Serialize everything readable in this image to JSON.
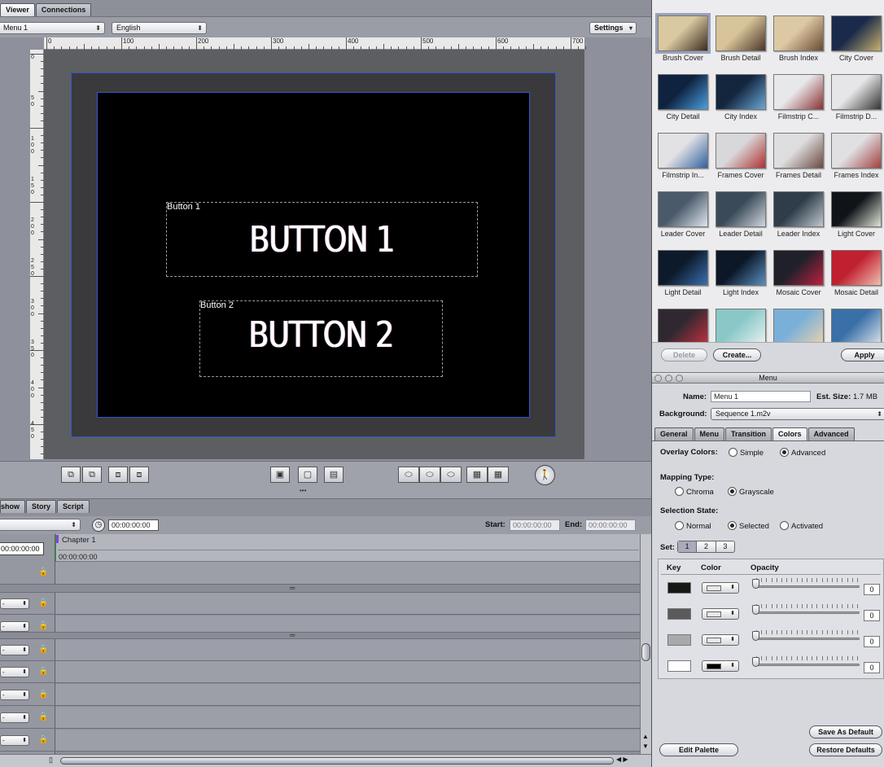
{
  "viewer": {
    "tabs": [
      "Viewer",
      "Connections"
    ],
    "menu_select": "Menu 1",
    "language_select": "English",
    "settings_label": "Settings",
    "ruler_h": [
      "0",
      "100",
      "200",
      "300",
      "400",
      "500",
      "600",
      "700"
    ],
    "ruler_v": [
      "0",
      "5\n0",
      "1\n0\n0",
      "1\n5\n0",
      "2\n0\n0",
      "2\n5\n0",
      "3\n0\n0",
      "3\n5\n0",
      "4\n0\n0",
      "4\n5\n0"
    ],
    "buttons": [
      {
        "caption": "Button 1",
        "text": "BUTTON 1"
      },
      {
        "caption": "Button 2",
        "text": "BUTTON 2"
      }
    ],
    "handle": "•••"
  },
  "timeline": {
    "tabs": [
      "show",
      "Story",
      "Script"
    ],
    "timecode": "00:00:00:00",
    "start_label": "Start:",
    "start_value": "00:00:00:00",
    "end_label": "End:",
    "end_value": "00:00:00:00",
    "chapter": "Chapter 1",
    "ruler_time": "00:00:00:00",
    "left_time": "00:00:00:00",
    "track_pop": "-"
  },
  "templates": {
    "items": [
      {
        "label": "Brush Cover",
        "c1": "#d9c8a0",
        "c2": "#3a2b20"
      },
      {
        "label": "Brush Detail",
        "c1": "#d8c49a",
        "c2": "#4a3528"
      },
      {
        "label": "Brush Index",
        "c1": "#dcc9a3",
        "c2": "#6b4a30"
      },
      {
        "label": "City Cover",
        "c1": "#1a2a4a",
        "c2": "#c8b070"
      },
      {
        "label": "City Detail",
        "c1": "#0f2340",
        "c2": "#4aa0e0"
      },
      {
        "label": "City Index",
        "c1": "#14263e",
        "c2": "#6aa8d8"
      },
      {
        "label": "Filmstrip C...",
        "c1": "#e8e8ea",
        "c2": "#8a3030"
      },
      {
        "label": "Filmstrip D...",
        "c1": "#e6e6e8",
        "c2": "#333333"
      },
      {
        "label": "Filmstrip In...",
        "c1": "#e2e2e4",
        "c2": "#3060a0"
      },
      {
        "label": "Frames Cover",
        "c1": "#d8d8da",
        "c2": "#b03030"
      },
      {
        "label": "Frames Detail",
        "c1": "#dedee0",
        "c2": "#6a4a40"
      },
      {
        "label": "Frames Index",
        "c1": "#e0e0e2",
        "c2": "#a04040"
      },
      {
        "label": "Leader Cover",
        "c1": "#4a5a6a",
        "c2": "#dfe6ee"
      },
      {
        "label": "Leader Detail",
        "c1": "#3a4a58",
        "c2": "#d0d6de"
      },
      {
        "label": "Leader Index",
        "c1": "#2f3d4a",
        "c2": "#c0c8d0"
      },
      {
        "label": "Light Cover",
        "c1": "#101418",
        "c2": "#e0e4d8"
      },
      {
        "label": "Light Detail",
        "c1": "#0c1a2a",
        "c2": "#3a70b0"
      },
      {
        "label": "Light Index",
        "c1": "#0c1828",
        "c2": "#5a90c0"
      },
      {
        "label": "Mosaic Cover",
        "c1": "#20202a",
        "c2": "#c02040"
      },
      {
        "label": "Mosaic Detail",
        "c1": "#c02030",
        "c2": "#f0c0b0"
      },
      {
        "label": "",
        "c1": "#302830",
        "c2": "#c03040"
      },
      {
        "label": "",
        "c1": "#8ac8c8",
        "c2": "#e8f0f0"
      },
      {
        "label": "",
        "c1": "#7ab0d8",
        "c2": "#e8d0b0"
      },
      {
        "label": "",
        "c1": "#3a70a8",
        "c2": "#d8e0e8"
      }
    ],
    "delete_label": "Delete",
    "create_label": "Create...",
    "apply_label": "Apply"
  },
  "menu_inspector": {
    "title": "Menu",
    "name_label": "Name:",
    "name_value": "Menu 1",
    "size_label": "Est. Size:",
    "size_value": "1.7 MB",
    "background_label": "Background:",
    "background_value": "Sequence 1.m2v",
    "tabs": [
      "General",
      "Menu",
      "Transition",
      "Colors",
      "Advanced"
    ],
    "overlay_label": "Overlay Colors:",
    "overlay_simple": "Simple",
    "overlay_advanced": "Advanced",
    "mapping_label": "Mapping Type:",
    "mapping_chroma": "Chroma",
    "mapping_grayscale": "Grayscale",
    "selection_label": "Selection State:",
    "sel_normal": "Normal",
    "sel_selected": "Selected",
    "sel_activated": "Activated",
    "set_label": "Set:",
    "sets": [
      "1",
      "2",
      "3"
    ],
    "col_key": "Key",
    "col_color": "Color",
    "col_opacity": "Opacity",
    "rows": [
      {
        "key": "#161816",
        "color": "#e8e8e8",
        "opacity": "0"
      },
      {
        "key": "#5a5a5c",
        "color": "#e8e8e8",
        "opacity": "0"
      },
      {
        "key": "#a9a9ab",
        "color": "#e8e8e8",
        "opacity": "0"
      },
      {
        "key": "#ffffff",
        "color": "#000000",
        "opacity": "0"
      }
    ],
    "save_default": "Save As Default",
    "restore_defaults": "Restore Defaults",
    "edit_palette": "Edit Palette"
  }
}
